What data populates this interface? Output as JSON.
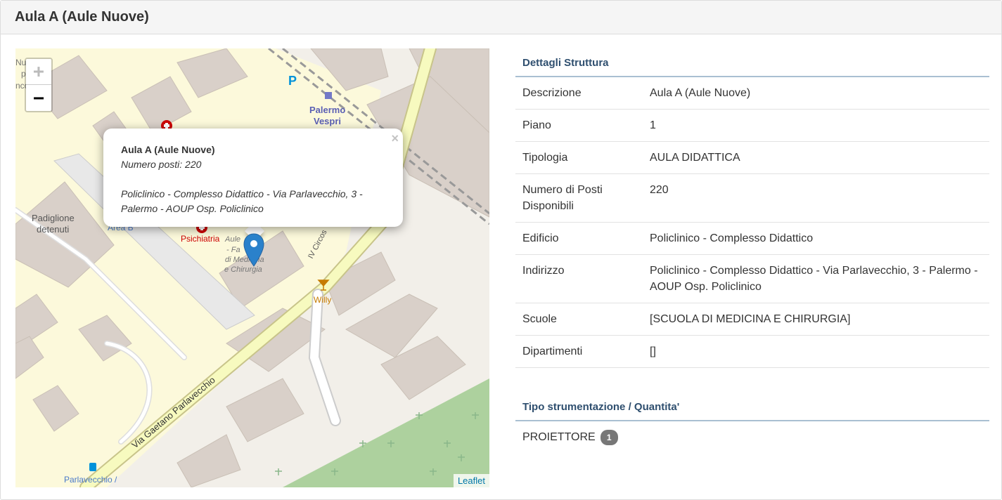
{
  "page": {
    "title": "Aula A (Aule Nuove)"
  },
  "map": {
    "zoom_in": "+",
    "zoom_out": "−",
    "popup": {
      "close": "×",
      "name": "Aula A (Aule Nuove)",
      "seats": "Numero posti: 220",
      "address": "Policlinico - Complesso Didattico - Via Parlavecchio, 3 - Palermo - AOUP Osp. Policlinico"
    },
    "attribution": "Leaflet",
    "labels": {
      "padiglione": "Padiglione",
      "detenuti": "detenuti",
      "area_b": "Area B",
      "psichiatria": "Psichiatria",
      "palermo": "Palermo",
      "vespri": "Vespri",
      "parking": "P",
      "willy": "Willy",
      "street": "Via Gaetano Parlavecchio",
      "street2": "IV Circos",
      "bus": "Parlavecchio /",
      "aule1": "Aule",
      "aule2": "- Fa",
      "aule3": "di Medicina",
      "aule4": "e Chirurgia",
      "corner1": "Nu",
      "corner2": "p",
      "corner3": "nco"
    }
  },
  "details": {
    "section_title": "Dettagli Struttura",
    "rows": [
      {
        "key": "Descrizione",
        "value": "Aula A (Aule Nuove)"
      },
      {
        "key": "Piano",
        "value": "1"
      },
      {
        "key": "Tipologia",
        "value": "AULA DIDATTICA"
      },
      {
        "key": "Numero di Posti Disponibili",
        "value": "220"
      },
      {
        "key": "Edificio",
        "value": "Policlinico - Complesso Didattico"
      },
      {
        "key": "Indirizzo",
        "value": "Policlinico - Complesso Didattico - Via Parlavecchio, 3 - Palermo - AOUP Osp. Policlinico"
      },
      {
        "key": "Scuole",
        "value": "[SCUOLA DI MEDICINA E CHIRURGIA]"
      },
      {
        "key": "Dipartimenti",
        "value": "[]"
      }
    ]
  },
  "equipment": {
    "section_title": "Tipo strumentazione / Quantita'",
    "items": [
      {
        "name": "PROIETTORE",
        "qty": "1"
      }
    ]
  }
}
